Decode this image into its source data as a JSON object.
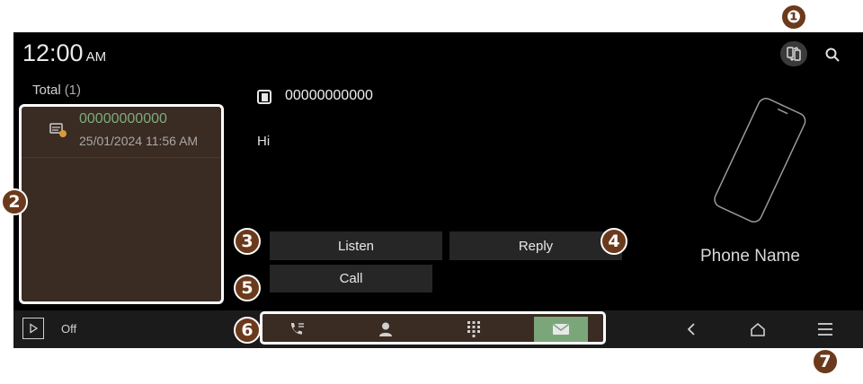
{
  "status": {
    "time": "12:00",
    "ampm": "AM"
  },
  "header": {
    "sync_icon": "phone-sync-icon",
    "search_icon": "search-icon"
  },
  "list": {
    "total_label": "Total",
    "total_count": "(1)",
    "items": [
      {
        "number": "00000000000",
        "datetime": "25/01/2024 11:56 AM",
        "icon": "message-icon"
      }
    ]
  },
  "detail": {
    "number": "00000000000",
    "text": "Hi"
  },
  "actions": {
    "listen": "Listen",
    "reply": "Reply",
    "call": "Call"
  },
  "phone": {
    "name": "Phone Name"
  },
  "bottom": {
    "media_state": "Off",
    "tabs": [
      {
        "icon": "call-history-icon",
        "active": false
      },
      {
        "icon": "contacts-icon",
        "active": false
      },
      {
        "icon": "dialpad-icon",
        "active": false
      },
      {
        "icon": "messages-icon",
        "active": true
      }
    ]
  },
  "callouts": [
    "❶",
    "2",
    "3",
    "4",
    "5",
    "6",
    "7"
  ],
  "colors": {
    "accent": "#7aa67a",
    "panel": "#3a2b23",
    "callout": "#6b3a1c",
    "number_green": "#7cae7a"
  }
}
